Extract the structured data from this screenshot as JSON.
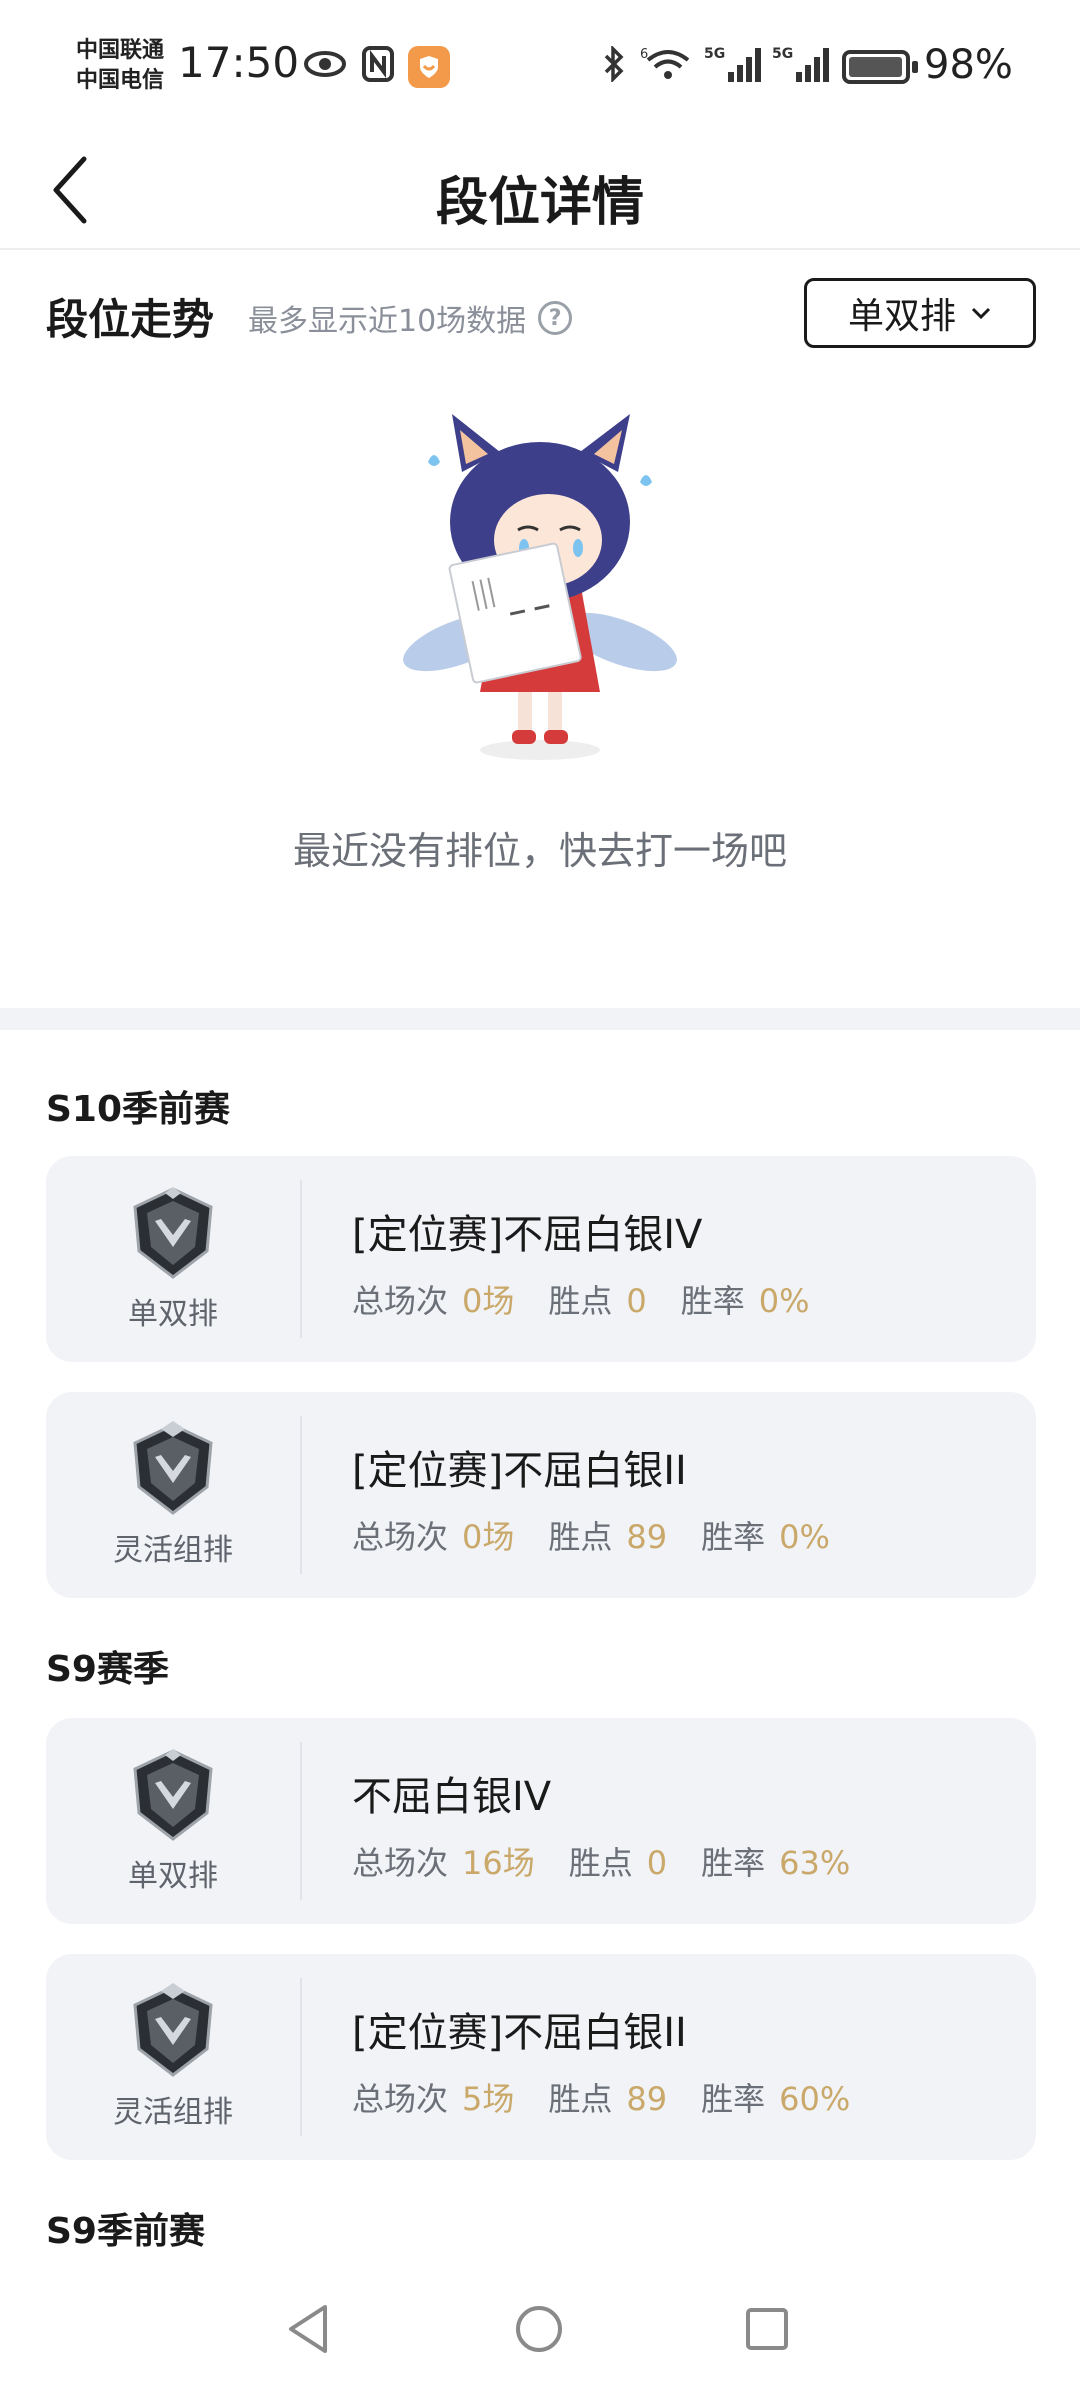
{
  "status_bar": {
    "carrier_1": "中国联通",
    "carrier_2": "中国电信",
    "time": "17:50",
    "battery_pct": "98%",
    "battery_level": 0.98,
    "net_1": "5G",
    "net_2": "5G",
    "wifi_tag": "6"
  },
  "header": {
    "title": "段位详情"
  },
  "trend": {
    "title": "段位走势",
    "hint": "最多显示近10场数据",
    "help": "?",
    "queue_select": "单双排",
    "empty_text": "最近没有排位，快去打一场吧"
  },
  "seasons": [
    {
      "name": "S10季前赛",
      "cards": [
        {
          "queue": "单双排",
          "rank": "[定位赛]不屈白银IV",
          "games_label": "总场次",
          "games": "0场",
          "lp_label": "胜点",
          "lp": "0",
          "wr_label": "胜率",
          "wr": "0%"
        },
        {
          "queue": "灵活组排",
          "rank": "[定位赛]不屈白银II",
          "games_label": "总场次",
          "games": "0场",
          "lp_label": "胜点",
          "lp": "89",
          "wr_label": "胜率",
          "wr": "0%"
        }
      ]
    },
    {
      "name": "S9赛季",
      "cards": [
        {
          "queue": "单双排",
          "rank": "不屈白银IV",
          "games_label": "总场次",
          "games": "16场",
          "lp_label": "胜点",
          "lp": "0",
          "wr_label": "胜率",
          "wr": "63%"
        },
        {
          "queue": "灵活组排",
          "rank": "[定位赛]不屈白银II",
          "games_label": "总场次",
          "games": "5场",
          "lp_label": "胜点",
          "lp": "89",
          "wr_label": "胜率",
          "wr": "60%"
        }
      ]
    },
    {
      "name": "S9季前赛",
      "cards": []
    }
  ],
  "colors": {
    "accent_gold": "#c9a86a",
    "card_bg": "#f1f3f7",
    "app_badge": "#f39a4a"
  }
}
